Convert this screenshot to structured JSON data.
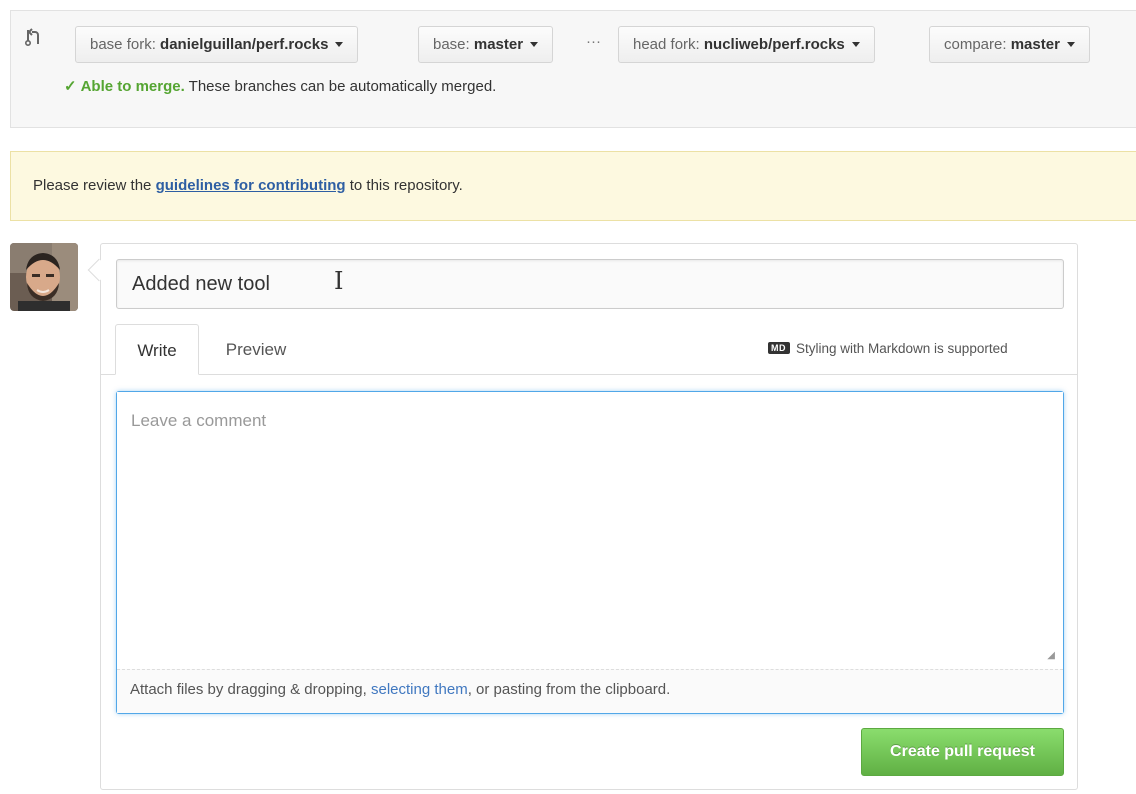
{
  "compare": {
    "icon": "git-compare-icon",
    "base_fork_prefix": "base fork: ",
    "base_fork_value": "danielguillan/perf.rocks",
    "base_prefix": "base: ",
    "base_value": "master",
    "ellipsis": "···",
    "head_fork_prefix": "head fork: ",
    "head_fork_value": "nucliweb/perf.rocks",
    "compare_prefix": "compare: ",
    "compare_value": "master",
    "merge_check": "✓",
    "merge_ok": "Able to merge.",
    "merge_text": " These branches can be automatically merged."
  },
  "flash": {
    "before": "Please review the ",
    "link": "guidelines for contributing",
    "after": " to this repository."
  },
  "form": {
    "avatar": "user-avatar",
    "title_value": "Added new tool",
    "cursor_glyph": "I",
    "tab_write": "Write",
    "tab_preview": "Preview",
    "markdown_icon_text": "MD",
    "markdown_note": "Styling with Markdown is supported",
    "comment_placeholder": "Leave a comment",
    "resize_glyph": "◢",
    "attach_before": "Attach files by dragging & dropping, ",
    "attach_link": "selecting them",
    "attach_after": ", or pasting from the clipboard.",
    "submit_label": "Create pull request"
  },
  "colors": {
    "success_green": "#55a532",
    "link_blue": "#4078c0",
    "flash_bg": "#fdf9e0",
    "focus_blue": "#51a7e8"
  }
}
